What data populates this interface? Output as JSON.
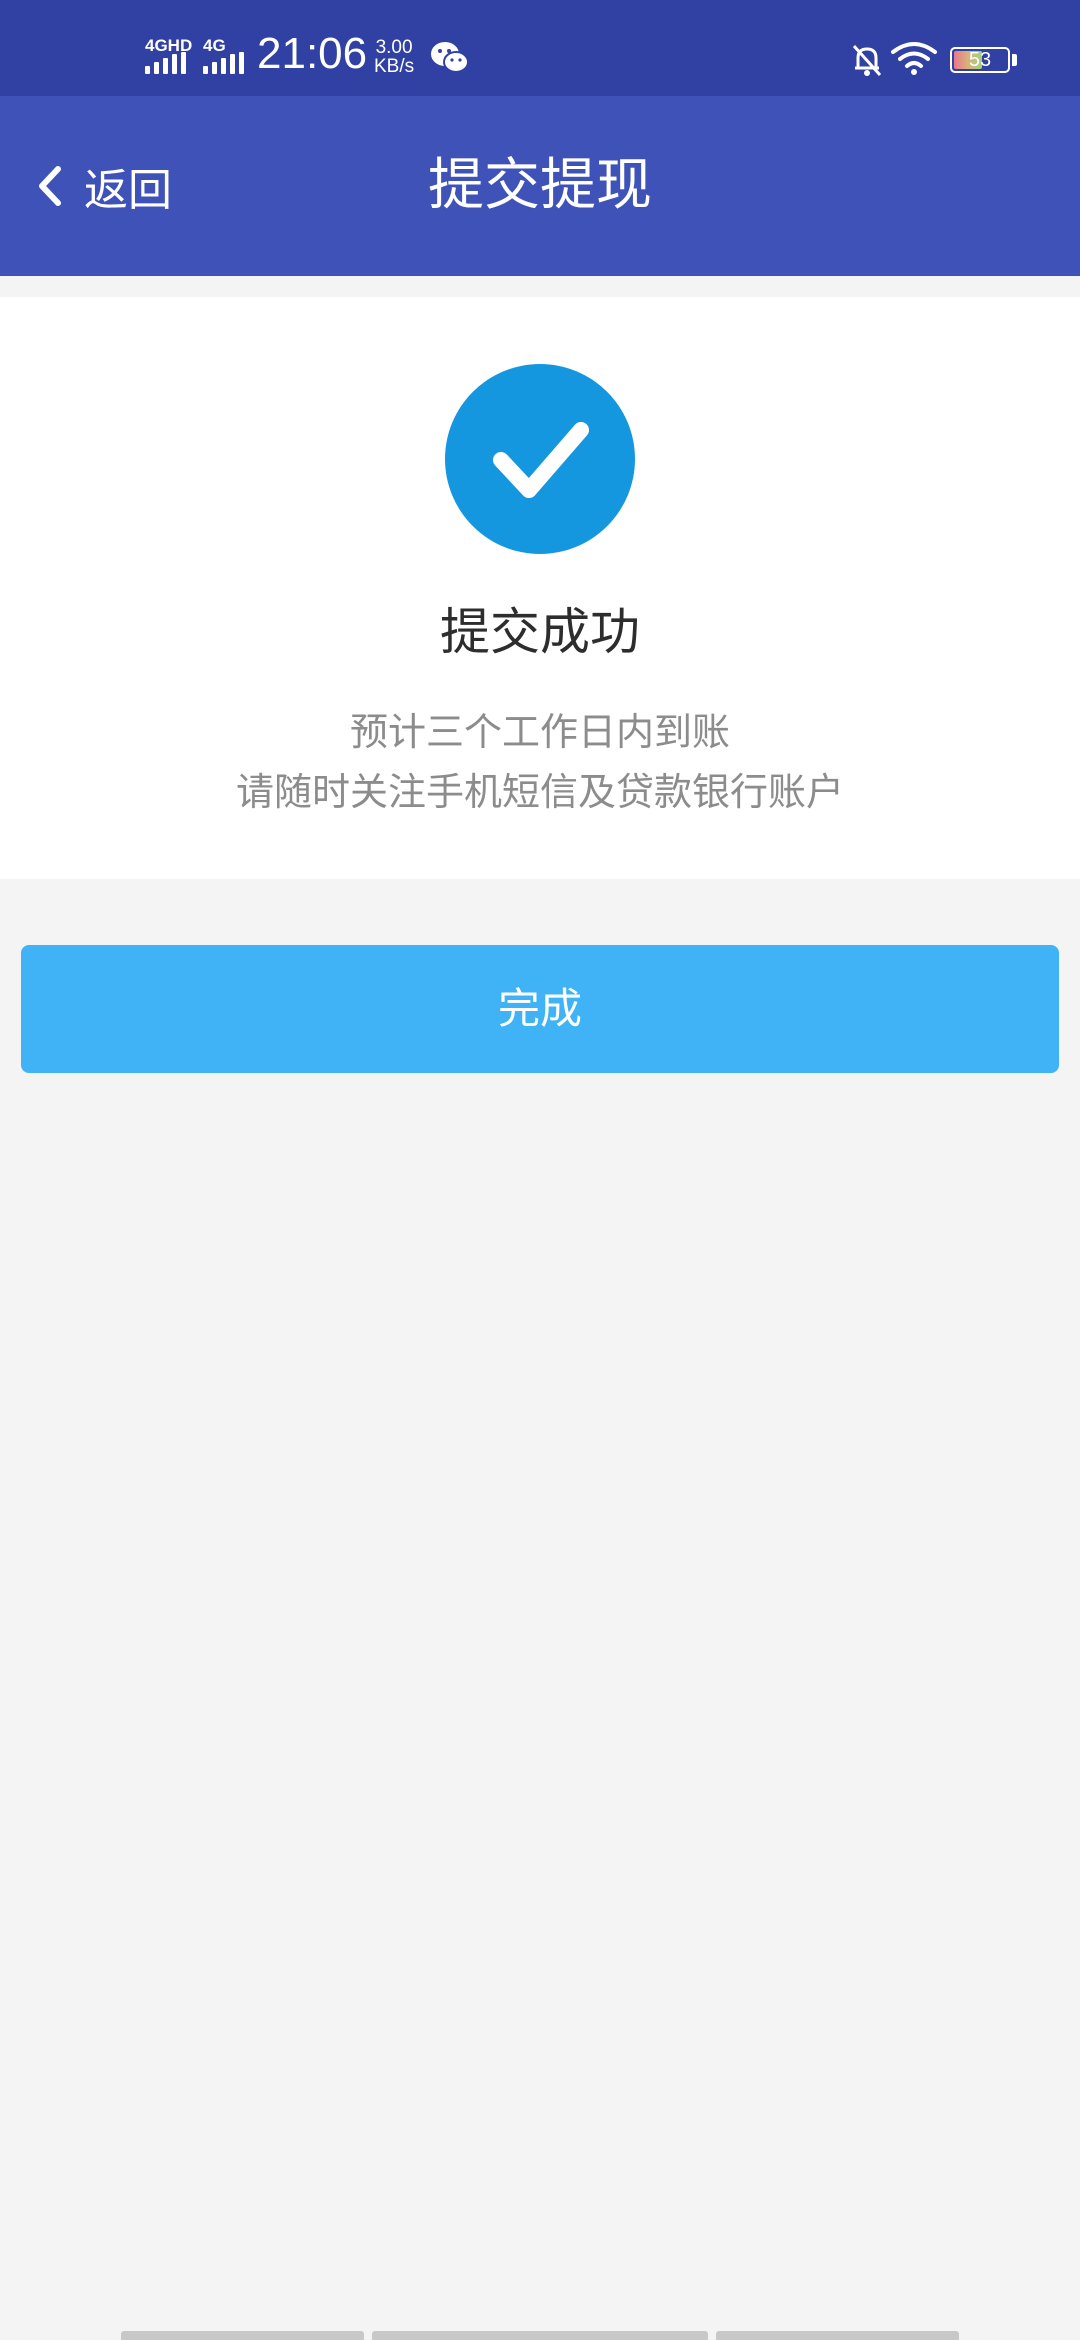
{
  "status_bar": {
    "network1": "4GHD",
    "network2": "4G",
    "time": "21:06",
    "speed_value": "3.00",
    "speed_unit": "KB/s",
    "battery_level": "53",
    "battery_fraction": 0.53
  },
  "nav": {
    "back_label": "返回",
    "title": "提交提现"
  },
  "result": {
    "title": "提交成功",
    "line1": "预计三个工作日内到账",
    "line2": "请随时关注手机短信及贷款银行账户"
  },
  "actions": {
    "done_label": "完成"
  },
  "colors": {
    "status_bar_bg": "#3041a3",
    "nav_bg": "#3f52b8",
    "check_circle": "#1597df",
    "done_button": "#3fb3f5",
    "page_bg": "#f4f4f4"
  }
}
